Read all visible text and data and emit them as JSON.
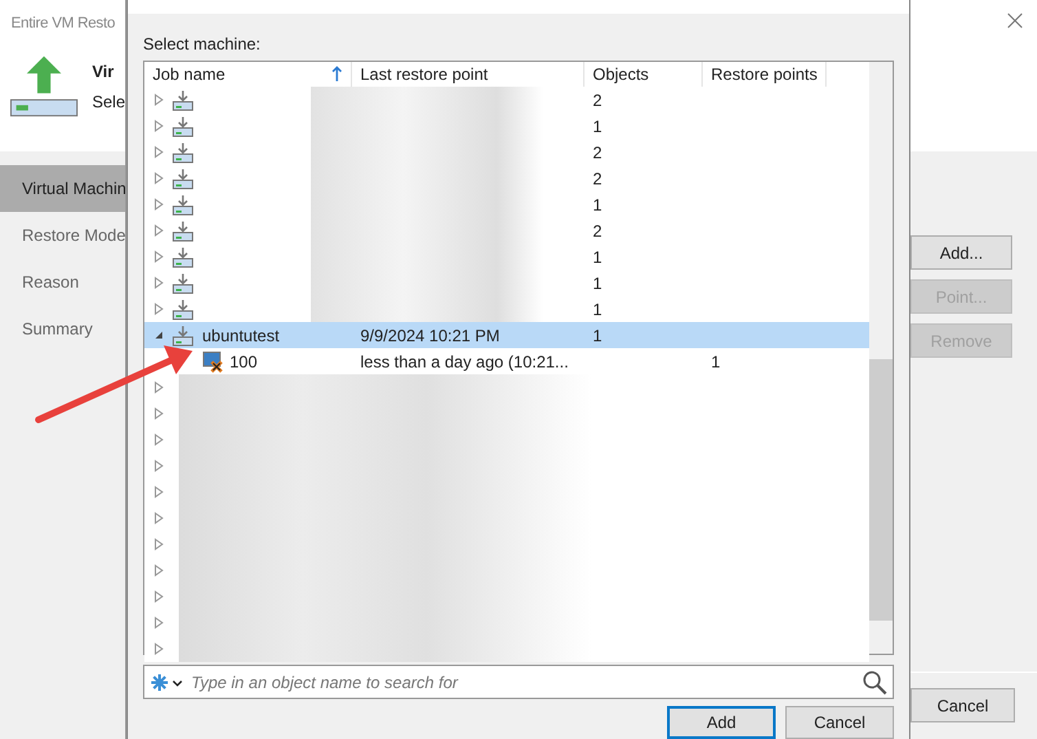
{
  "background_window": {
    "title": "Entire VM Resto",
    "header_title": "Vir",
    "header_subtitle": "Sele",
    "nav": [
      {
        "label": "Virtual Machin",
        "selected": true
      },
      {
        "label": "Restore Mode",
        "selected": false
      },
      {
        "label": "Reason",
        "selected": false
      },
      {
        "label": "Summary",
        "selected": false
      }
    ],
    "buttons": [
      {
        "label": "Add...",
        "disabled": false
      },
      {
        "label": "Point...",
        "disabled": true
      },
      {
        "label": "Remove",
        "disabled": true
      }
    ],
    "cancel": "Cancel"
  },
  "dialog": {
    "prompt": "Select machine:",
    "columns": [
      {
        "label": "Job name",
        "sorted": true
      },
      {
        "label": "Last restore point",
        "sorted": false
      },
      {
        "label": "Objects",
        "sorted": false
      },
      {
        "label": "Restore points",
        "sorted": false
      }
    ],
    "rows": [
      {
        "objects": "2",
        "expanded": false,
        "selected": false
      },
      {
        "objects": "1",
        "expanded": false,
        "selected": false
      },
      {
        "objects": "2",
        "expanded": false,
        "selected": false
      },
      {
        "objects": "2",
        "expanded": false,
        "selected": false
      },
      {
        "objects": "1",
        "expanded": false,
        "selected": false
      },
      {
        "objects": "2",
        "expanded": false,
        "selected": false
      },
      {
        "objects": "1",
        "expanded": false,
        "selected": false
      },
      {
        "objects": "1",
        "expanded": false,
        "selected": false
      },
      {
        "objects": "1",
        "expanded": false,
        "selected": false
      },
      {
        "name": "ubuntutest",
        "last_restore_point": "9/9/2024 10:21 PM",
        "objects": "1",
        "expanded": true,
        "selected": true,
        "children": [
          {
            "name": "100",
            "last_restore_point": "less than a day ago (10:21...",
            "restore_points": "1"
          }
        ]
      },
      {
        "expanded": false,
        "selected": false
      },
      {
        "expanded": false,
        "selected": false
      },
      {
        "expanded": false,
        "selected": false
      },
      {
        "expanded": false,
        "selected": false
      },
      {
        "expanded": false,
        "selected": false
      },
      {
        "expanded": false,
        "selected": false
      },
      {
        "expanded": false,
        "selected": false
      },
      {
        "expanded": false,
        "selected": false
      },
      {
        "expanded": false,
        "selected": false
      },
      {
        "expanded": false,
        "selected": false
      },
      {
        "expanded": false,
        "selected": false
      }
    ],
    "search": {
      "placeholder": "Type in an object name to search for"
    },
    "buttons": [
      {
        "label": "Add",
        "default": true
      },
      {
        "label": "Cancel",
        "default": false
      }
    ]
  }
}
